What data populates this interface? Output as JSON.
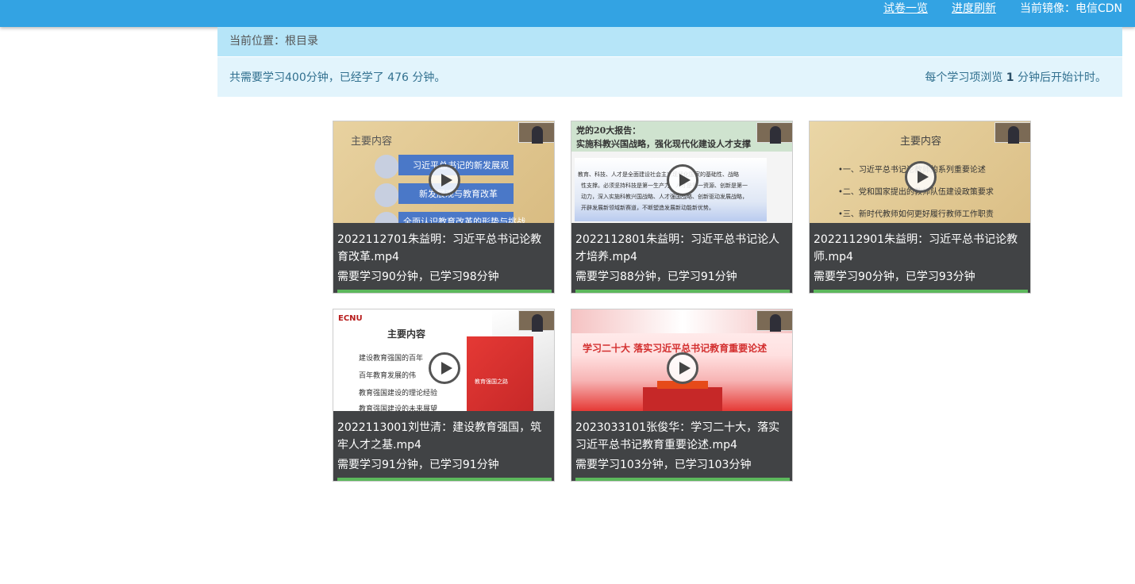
{
  "header": {
    "exam_link": "试卷一览",
    "refresh_link": "进度刷新",
    "mirror_text": "当前镜像：电信CDN"
  },
  "breadcrumb": "当前位置：根目录",
  "summary": {
    "left_prefix": "共需要学习400分钟，已经学了 476 分钟。",
    "right_before": "每个学习项浏览 ",
    "right_value": "1",
    "right_after": " 分钟后开始计时。"
  },
  "videos": [
    {
      "title": "2022112701朱益明：习近平总书记论教育改革.mp4",
      "stat": "需要学习90分钟，已学习98分钟",
      "progress": 1.0,
      "slide": {
        "heading": "主要内容",
        "items": [
          "习近平总书记的新发展观",
          "新发展观与教育改革",
          "全面认识教育改革的形势与挑战"
        ]
      }
    },
    {
      "title": "2022112801朱益明：习近平总书记论人才培养.mp4",
      "stat": "需要学习88分钟，已学习91分钟",
      "progress": 1.0,
      "slide": {
        "heading": "党的20大报告：",
        "subheading": "实施科教兴国战略，强化现代化建设人才支撑",
        "body": [
          "教育、科技、人才是全面建设社会主义现代化国家的基础性、战略",
          "性支撑。必须坚持科技是第一生产力、人才是第一资源、创新是第一",
          "动力，深入实施科教兴国战略、人才强国战略、创新驱动发展战略，",
          "开辟发展新领域新赛道，不断塑造发展新动能新优势。"
        ]
      }
    },
    {
      "title": "2022112901朱益明：习近平总书记论教师.mp4",
      "stat": "需要学习90分钟，已学习93分钟",
      "progress": 1.0,
      "slide": {
        "heading": "主要内容",
        "items": [
          "•一、习近平总书记论教师的系列重要论述",
          "•二、党和国家提出的教师队伍建设政策要求",
          "•三、新时代教师如何更好履行教师工作职责"
        ]
      }
    },
    {
      "title": "2022113001刘世清：建设教育强国，筑牢人才之基.mp4",
      "stat": "需要学习91分钟，已学习91分钟",
      "progress": 1.0,
      "slide": {
        "logo": "ECNU",
        "heading": "主要内容",
        "items": [
          "建设教育强国的百年",
          "百年教育发展的伟",
          "教育强国建设的理论经验",
          "教育强国建设的未来展望"
        ],
        "book": "教育强国之路"
      }
    },
    {
      "title": "2023033101张俊华：学习二十大，落实习近平总书记教育重要论述.mp4",
      "stat": "需要学习103分钟，已学习103分钟",
      "progress": 1.0,
      "slide": {
        "heading": "学习二十大  落实习近平总书记教育重要论述"
      }
    }
  ]
}
